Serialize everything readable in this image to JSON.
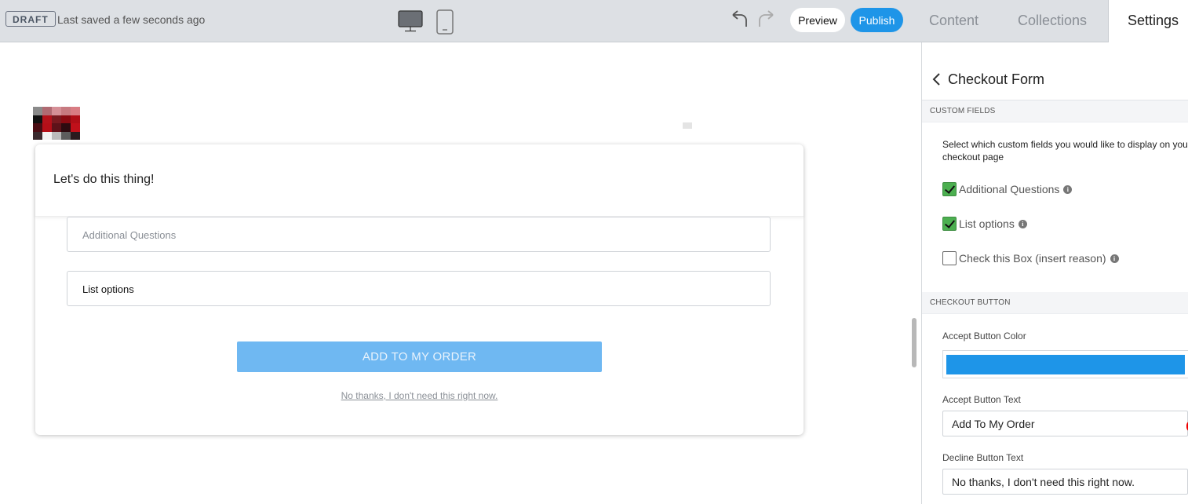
{
  "topbar": {
    "draft_label": "DRAFT",
    "saved_text": "Last saved a few seconds ago",
    "preview_label": "Preview",
    "publish_label": "Publish"
  },
  "tabs": [
    {
      "label": "Content"
    },
    {
      "label": "Collections"
    },
    {
      "label": "Settings"
    }
  ],
  "form": {
    "title": "Let's do this thing!",
    "field1_placeholder": "Additional Questions",
    "field2_value": "List options",
    "accept_label": "ADD TO MY ORDER",
    "decline_label": "No thanks, I don't need this right now."
  },
  "panel": {
    "title": "Checkout Form",
    "section_custom": "CUSTOM FIELDS",
    "description": "Select which custom fields you would like to display on your checkout page",
    "checkboxes": [
      {
        "label": "Additional Questions",
        "checked": true
      },
      {
        "label": "List options",
        "checked": true
      },
      {
        "label": "Check this Box (insert reason)",
        "checked": false
      }
    ],
    "section_button": "CHECKOUT BUTTON",
    "accept_color_label": "Accept Button Color",
    "accept_color": "#1e95e8",
    "accept_text_label": "Accept Button Text",
    "accept_text_value": "Add To My Order",
    "decline_text_label": "Decline Button Text",
    "decline_text_value": "No thanks, I don't need this right now."
  }
}
